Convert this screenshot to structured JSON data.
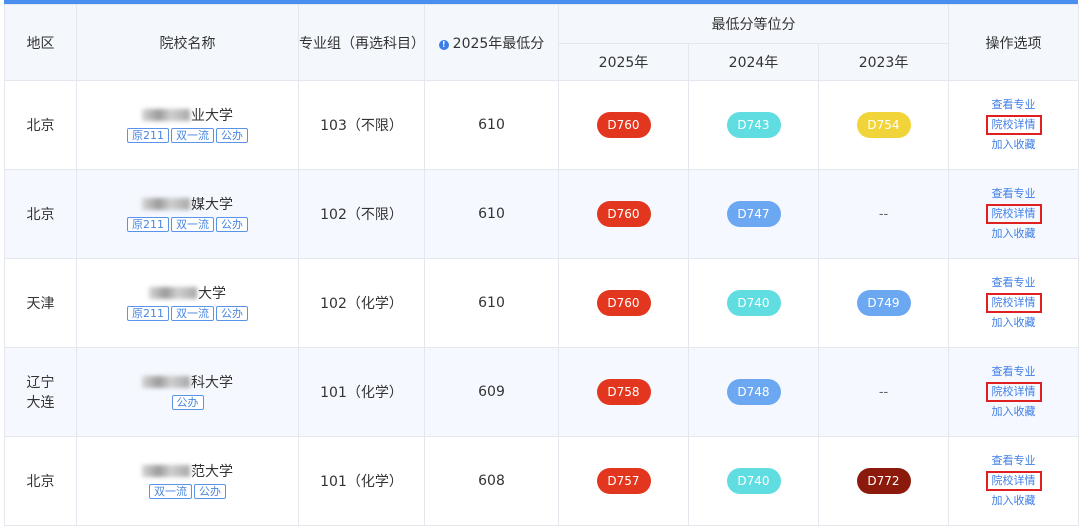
{
  "header": {
    "region": "地区",
    "school": "院校名称",
    "group": "专业组（再选科目）",
    "min_score": "2025年最低分",
    "rank_title": "最低分等位分",
    "y2025": "2025年",
    "y2024": "2024年",
    "y2023": "2023年",
    "ops": "操作选项"
  },
  "colors": {
    "accent": "#4a8ef0",
    "pill_red": "#e2361e",
    "pill_cyan": "#5fdde0",
    "pill_blue": "#6ca8f2",
    "pill_yellow": "#f0d43a",
    "pill_darkred": "#8b1a0c",
    "link": "#3f7ee6",
    "highlight_border": "#e02020"
  },
  "actions": {
    "view_major": "查看专业",
    "school_detail": "院校详情",
    "add_favorite": "加入收藏"
  },
  "rows": [
    {
      "region": "北京",
      "name_suffix": "业大学",
      "tags": [
        "原211",
        "双一流",
        "公办"
      ],
      "group": "103（不限）",
      "min": "610",
      "r2025": {
        "text": "D760",
        "color": "#e2361e"
      },
      "r2024": {
        "text": "D743",
        "color": "#5fdde0"
      },
      "r2023": {
        "text": "D754",
        "color": "#f0d43a"
      }
    },
    {
      "region": "北京",
      "name_suffix": "媒大学",
      "tags": [
        "原211",
        "双一流",
        "公办"
      ],
      "group": "102（不限）",
      "min": "610",
      "r2025": {
        "text": "D760",
        "color": "#e2361e"
      },
      "r2024": {
        "text": "D747",
        "color": "#6ca8f2"
      },
      "r2023": {
        "text": "--",
        "color": ""
      }
    },
    {
      "region": "天津",
      "name_suffix": "大学",
      "tags": [
        "原211",
        "双一流",
        "公办"
      ],
      "group": "102（化学）",
      "min": "610",
      "r2025": {
        "text": "D760",
        "color": "#e2361e"
      },
      "r2024": {
        "text": "D740",
        "color": "#5fdde0"
      },
      "r2023": {
        "text": "D749",
        "color": "#6ca8f2"
      }
    },
    {
      "region": "辽宁大连",
      "region_lines": [
        "辽宁",
        "大连"
      ],
      "name_suffix": "科大学",
      "tags": [
        "公办"
      ],
      "group": "101（化学）",
      "min": "609",
      "r2025": {
        "text": "D758",
        "color": "#e2361e"
      },
      "r2024": {
        "text": "D748",
        "color": "#6ca8f2"
      },
      "r2023": {
        "text": "--",
        "color": ""
      }
    },
    {
      "region": "北京",
      "name_suffix": "范大学",
      "tags": [
        "双一流",
        "公办"
      ],
      "group": "101（化学）",
      "min": "608",
      "r2025": {
        "text": "D757",
        "color": "#e2361e"
      },
      "r2024": {
        "text": "D740",
        "color": "#5fdde0"
      },
      "r2023": {
        "text": "D772",
        "color": "#8b1a0c"
      }
    }
  ]
}
